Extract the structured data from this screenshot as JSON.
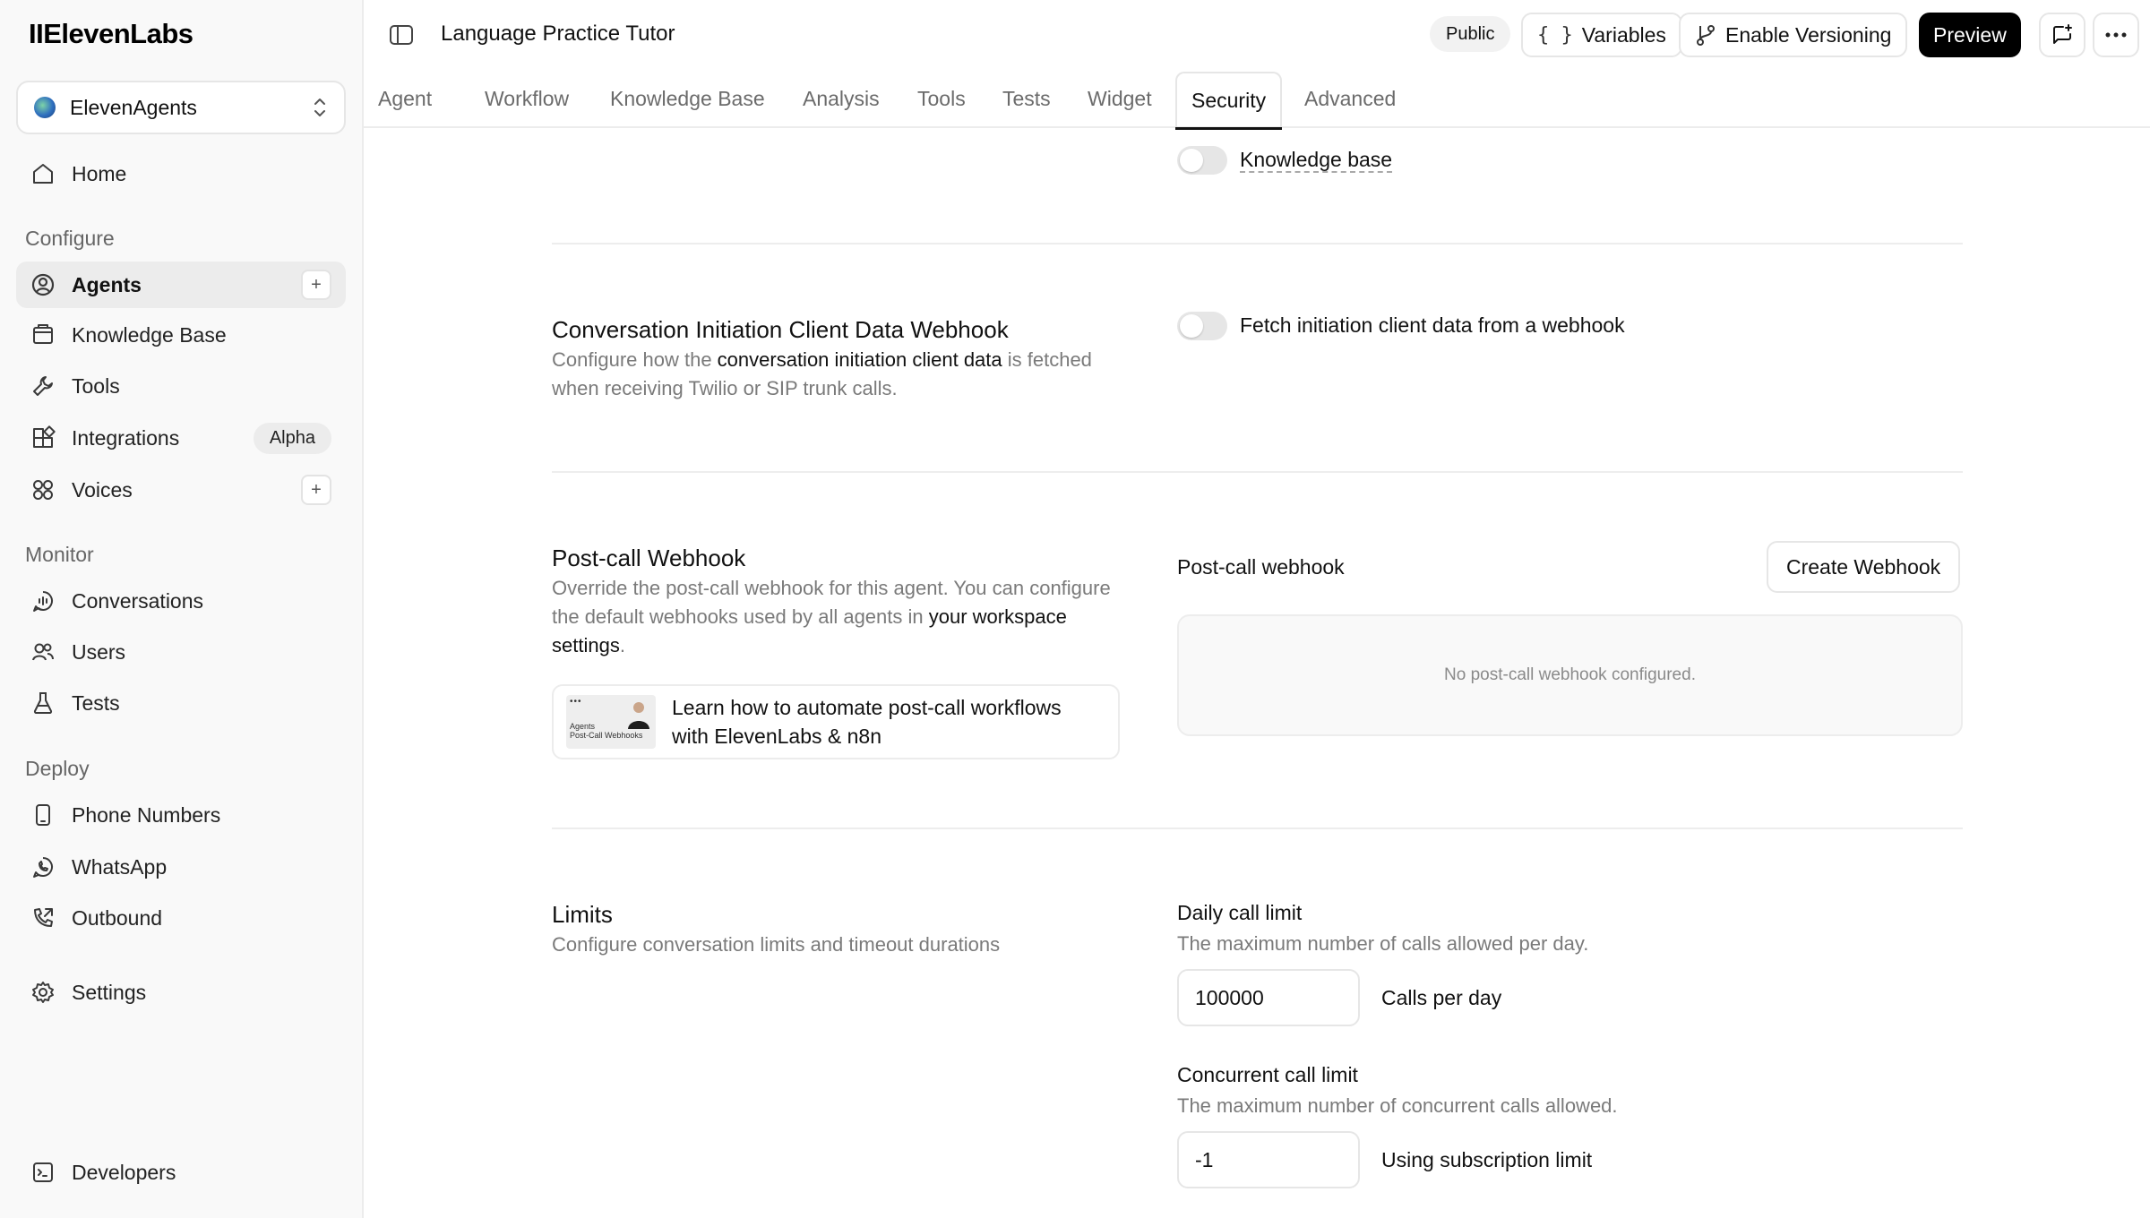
{
  "sidebar": {
    "logo": "IIElevenLabs",
    "workspace": "ElevenAgents",
    "home": "Home",
    "sections": {
      "configure": "Configure",
      "monitor": "Monitor",
      "deploy": "Deploy"
    },
    "items": {
      "agents": "Agents",
      "knowledge_base": "Knowledge Base",
      "tools": "Tools",
      "integrations": "Integrations",
      "integrations_badge": "Alpha",
      "voices": "Voices",
      "conversations": "Conversations",
      "users": "Users",
      "tests": "Tests",
      "phone_numbers": "Phone Numbers",
      "whatsapp": "WhatsApp",
      "outbound": "Outbound",
      "settings": "Settings",
      "developers": "Developers"
    },
    "plus": "+"
  },
  "header": {
    "title": "Language Practice Tutor",
    "public_badge": "Public",
    "variables": "Variables",
    "enable_versioning": "Enable Versioning",
    "preview": "Preview"
  },
  "tabs": [
    "Agent",
    "Workflow",
    "Knowledge Base",
    "Analysis",
    "Tools",
    "Tests",
    "Widget",
    "Security",
    "Advanced"
  ],
  "active_tab": "Security",
  "content": {
    "knowledge_base_toggle": "Knowledge base",
    "initiation": {
      "title": "Conversation Initiation Client Data Webhook",
      "desc_pre": "Configure how the ",
      "desc_link": "conversation initiation client data",
      "desc_post": " is fetched when receiving Twilio or SIP trunk calls.",
      "toggle_label": "Fetch initiation client data from a webhook"
    },
    "postcall": {
      "title": "Post-call Webhook",
      "desc_pre": "Override the post-call webhook for this agent. You can configure the default webhooks used by all agents in ",
      "desc_link": "your workspace settings",
      "desc_post": ".",
      "learn_line1": "Learn how to automate post-call workflows",
      "learn_line2": "with ElevenLabs & n8n",
      "thumb_text1": "Agents",
      "thumb_text2": "Post-Call Webhooks",
      "field_label": "Post-call webhook",
      "create_button": "Create Webhook",
      "empty_text": "No post-call webhook configured."
    },
    "limits": {
      "title": "Limits",
      "desc": "Configure conversation limits and timeout durations",
      "daily_label": "Daily call limit",
      "daily_desc": "The maximum number of calls allowed per day.",
      "daily_value": "100000",
      "daily_suffix": "Calls per day",
      "concurrent_label": "Concurrent call limit",
      "concurrent_desc": "The maximum number of concurrent calls allowed.",
      "concurrent_value": "-1",
      "concurrent_suffix": "Using subscription limit"
    }
  },
  "toggles": {
    "knowledge_base": false,
    "fetch_initiation": false
  }
}
